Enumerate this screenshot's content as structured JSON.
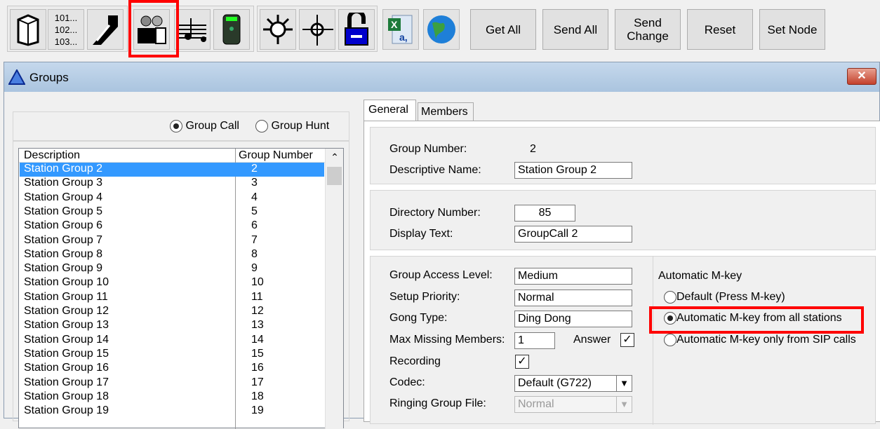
{
  "toolbar": {
    "icons": [
      "cabinet-icon",
      "number-list-icon",
      "phone-icon",
      "groups-icon",
      "music-icon",
      "pager-icon",
      "network-icon",
      "move-icon",
      "lock-icon",
      "excel-icon",
      "globe-icon"
    ],
    "number_list_text": "101...\n102...\n103...",
    "buttons": [
      "Get All",
      "Send All",
      "Send\nChange",
      "Reset",
      "Set Node"
    ]
  },
  "window": {
    "title": "Groups",
    "close": "✕"
  },
  "left": {
    "group_call": "Group Call",
    "group_hunt": "Group Hunt",
    "col_description": "Description",
    "col_number": "Group Number",
    "rows": [
      [
        "Station Group 2",
        "2"
      ],
      [
        "Station Group 3",
        "3"
      ],
      [
        "Station Group 4",
        "4"
      ],
      [
        "Station Group 5",
        "5"
      ],
      [
        "Station Group 6",
        "6"
      ],
      [
        "Station Group 7",
        "7"
      ],
      [
        "Station Group 8",
        "8"
      ],
      [
        "Station Group 9",
        "9"
      ],
      [
        "Station Group 10",
        "10"
      ],
      [
        "Station Group 11",
        "11"
      ],
      [
        "Station Group 12",
        "12"
      ],
      [
        "Station Group 13",
        "13"
      ],
      [
        "Station Group 14",
        "14"
      ],
      [
        "Station Group 15",
        "15"
      ],
      [
        "Station Group 16",
        "16"
      ],
      [
        "Station Group 17",
        "17"
      ],
      [
        "Station Group 18",
        "18"
      ],
      [
        "Station Group 19",
        "19"
      ]
    ]
  },
  "tabs": {
    "general": "General",
    "members": "Members"
  },
  "general": {
    "group_number_label": "Group Number:",
    "group_number": "2",
    "desc_name_label": "Descriptive Name:",
    "desc_name": "Station Group 2",
    "dir_label": "Directory Number:",
    "dir": "85",
    "display_label": "Display Text:",
    "display": "GroupCall 2",
    "access_label": "Group Access Level:",
    "access": "Medium",
    "priority_label": "Setup Priority:",
    "priority": "Normal",
    "gong_label": "Gong Type:",
    "gong": "Ding Dong",
    "missing_label": "Max Missing Members:",
    "missing": "1",
    "answer_label": "Answer",
    "recording_label": "Recording",
    "codec_label": "Codec:",
    "codec": "Default (G722)",
    "ringing_label": "Ringing Group File:",
    "ringing": "Normal",
    "mkey_title": "Automatic M-key",
    "mkey_default": "Default (Press M-key)",
    "mkey_all": "Automatic M-key from all stations",
    "mkey_sip": "Automatic M-key only from SIP calls"
  },
  "colors": {
    "highlight": "#ff0000",
    "selection": "#3399ff"
  }
}
